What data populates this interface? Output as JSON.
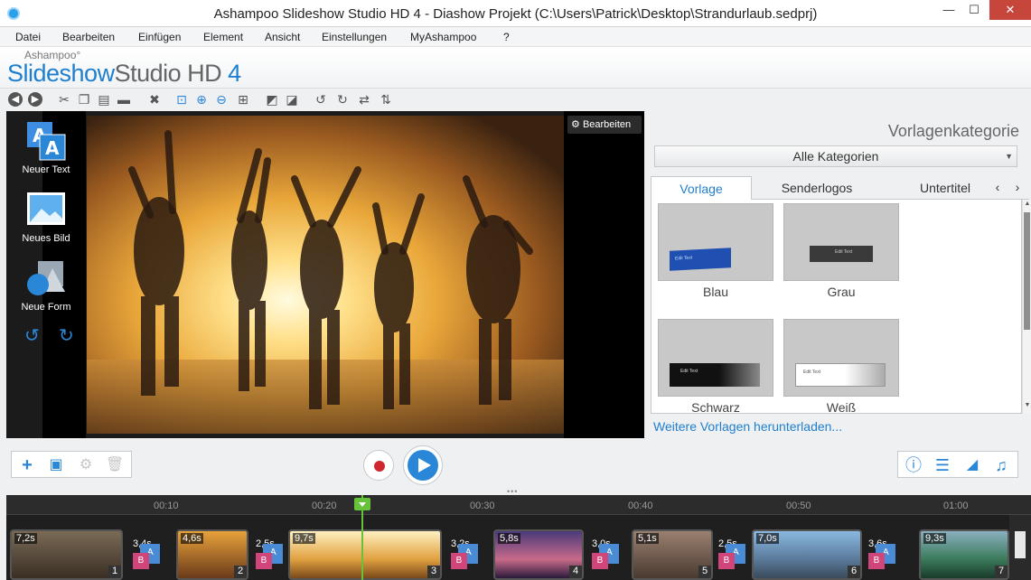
{
  "window": {
    "title": "Ashampoo Slideshow Studio HD 4 - Diashow Projekt (C:\\Users\\Patrick\\Desktop\\Strandurlaub.sedprj)",
    "minimize": "—",
    "maximize": "☐",
    "close": "✕"
  },
  "menu": {
    "items": [
      "Datei",
      "Bearbeiten",
      "Einfügen",
      "Element",
      "Ansicht",
      "Einstellungen",
      "MyAshampoo",
      "?"
    ]
  },
  "brand": {
    "small": "Ashampoo°",
    "name_part1": "Slideshow",
    "name_part2": "Studio HD ",
    "version": "4"
  },
  "stage": {
    "tools": [
      {
        "label": "Neuer Text",
        "icon": "text-tool-icon"
      },
      {
        "label": "Neues Bild",
        "icon": "image-tool-icon"
      },
      {
        "label": "Neue Form",
        "icon": "shape-tool-icon"
      }
    ],
    "edit_label": "Bearbeiten"
  },
  "panel": {
    "heading": "Vorlagenkategorie",
    "category": "Alle Kategorien",
    "tabs": [
      "Vorlage",
      "Senderlogos",
      "Untertitel"
    ],
    "templates": [
      {
        "label": "Blau",
        "sample": "Edit Text"
      },
      {
        "label": "Grau",
        "sample": "Edit Text"
      },
      {
        "label": "Schwarz",
        "sample": "Edit Text"
      },
      {
        "label": "Weiß",
        "sample": "Edit Text"
      }
    ],
    "more_link": "Weitere Vorlagen herunterladen..."
  },
  "timeline": {
    "ticks": [
      "00:10",
      "00:20",
      "00:30",
      "00:40",
      "00:50",
      "01:00"
    ],
    "clips": [
      {
        "duration": "7,2s",
        "number": "1",
        "color": "#7a6a55"
      },
      {
        "duration": "4,6s",
        "number": "2",
        "color": "#d88a2a"
      },
      {
        "duration": "9,7s",
        "number": "3",
        "color": "#f0b040"
      },
      {
        "duration": "5,8s",
        "number": "4",
        "color": "#6a4f8a"
      },
      {
        "duration": "5,1s",
        "number": "5",
        "color": "#8a6a5a"
      },
      {
        "duration": "7,0s",
        "number": "6",
        "color": "#6a9ac8"
      },
      {
        "duration": "9,3s",
        "number": "7",
        "color": "#4a8a6a"
      }
    ],
    "transitions": [
      "3,4s",
      "2,5s",
      "3,2s",
      "3,0s",
      "2,5s",
      "3,6s"
    ]
  },
  "colors": {
    "accent": "#1f7fcf",
    "record": "#d0262f",
    "playhead": "#67c23a"
  }
}
